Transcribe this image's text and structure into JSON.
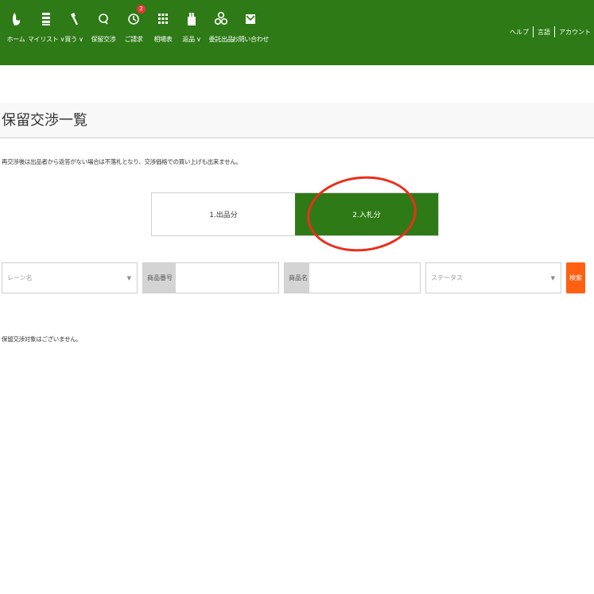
{
  "header": {
    "nav_items": [
      {
        "name": "home",
        "label": "ホーム",
        "icon": "home-icon"
      },
      {
        "name": "mylist",
        "label": "マイリスト",
        "icon": "list-icon",
        "dropdown": true
      },
      {
        "name": "buy",
        "label": "買う",
        "icon": "gavel-icon",
        "dropdown": true
      },
      {
        "name": "hold",
        "label": "保留交渉",
        "icon": "chat-icon"
      },
      {
        "name": "invoice",
        "label": "ご請求",
        "icon": "invoice-icon",
        "badge": "2"
      },
      {
        "name": "market",
        "label": "相場表",
        "icon": "grid-icon"
      },
      {
        "name": "return",
        "label": "返品",
        "icon": "return-icon",
        "dropdown": true
      },
      {
        "name": "consign",
        "label": "委託出品",
        "icon": "consign-icon"
      },
      {
        "name": "contact",
        "label": "お問い合わせ",
        "icon": "mail-icon"
      }
    ],
    "dropdown_mark": "∨",
    "links": [
      "ヘルプ",
      "言語",
      "アカウント"
    ],
    "bar_color": "#2d7a16"
  },
  "page": {
    "title": "保留交渉一覧",
    "notice": "再交渉後は出品者から返答がない場合は不落札となり、交渉価格での買い上げも出来ません。",
    "tabs": [
      {
        "label": "1.出品分",
        "active": false
      },
      {
        "label": "2.入札分",
        "active": true
      }
    ],
    "filters": {
      "lane_placeholder": "レーン名",
      "product_number_label": "商品番号",
      "product_number_value": "",
      "product_name_label": "商品名",
      "product_name_value": "",
      "status_placeholder": "ステータス",
      "search_label": "検索"
    },
    "empty_message": "保留交渉対象はございません。"
  },
  "colors": {
    "accent": "#2d7a16",
    "search_button": "#ff6011",
    "annotation": "#e8301c"
  }
}
